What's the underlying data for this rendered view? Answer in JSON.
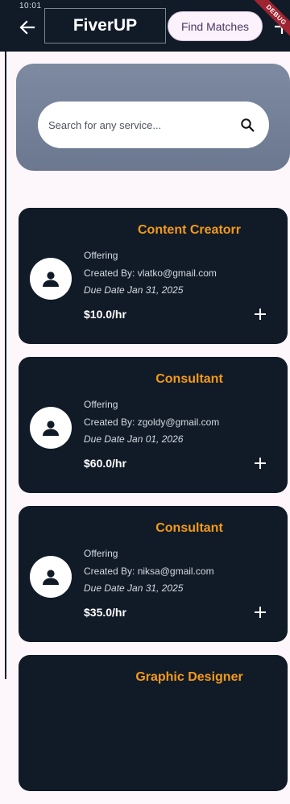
{
  "status_bar": {
    "time": "10:01"
  },
  "app_bar": {
    "title": "FiverUP",
    "find_matches_label": "Find Matches",
    "debug_banner": "DEBUG",
    "back_icon": "arrow-left-icon",
    "add_icon": "plus-icon"
  },
  "search": {
    "placeholder": "Search for any service...",
    "icon": "search-icon"
  },
  "colors": {
    "app_bar": "#111b28",
    "accent": "#f59a18",
    "card_bg": "#111b28",
    "panel": "#75829a",
    "page_bg": "#fdf7fb"
  },
  "cards": [
    {
      "title": "Content Creatorr",
      "type": "Offering",
      "creator": "Created By: vlatko@gmail.com",
      "due": "Due Date Jan 31, 2025",
      "price": "$10.0/hr"
    },
    {
      "title": "Consultant",
      "type": "Offering",
      "creator": "Created By: zgoldy@gmail.com",
      "due": "Due Date Jan 01, 2026",
      "price": "$60.0/hr"
    },
    {
      "title": "Consultant",
      "type": "Offering",
      "creator": "Created By: niksa@gmail.com",
      "due": "Due Date Jan 31, 2025",
      "price": "$35.0/hr"
    },
    {
      "title": "Graphic Designer"
    }
  ]
}
